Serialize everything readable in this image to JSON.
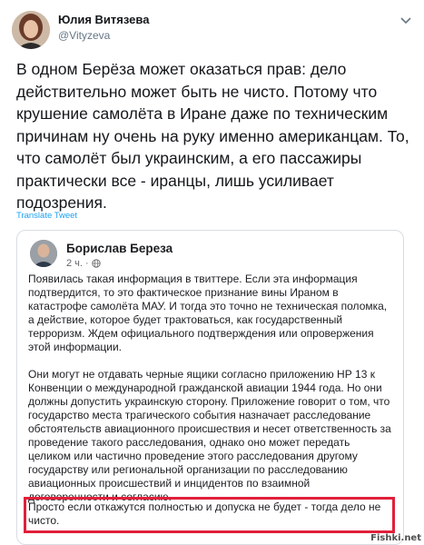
{
  "author": {
    "name": "Юлия Витязева",
    "handle": "@Vityzeva"
  },
  "tweet": {
    "text": "В одном Берёза может оказаться прав: дело действительно может быть не чисто. Потому что крушение самолёта в Иране даже по техническим причинам ну очень на руку именно американцам. То, что самолёт был украинским, а его пассажиры практически все - иранцы, лишь усиливает подозрения.",
    "translate_label": "Translate Tweet"
  },
  "quoted_post": {
    "author_name": "Борислав Береза",
    "time": "2 ч.",
    "paragraph_1": "Появилась такая информация в твиттере. Если эта информация подтвердится, то это фактическое признание вины Ираном в катастрофе самолёта МАУ. И тогда это точно не техническая поломка, а действие, которое будет трактоваться, как государственный терроризм. Ждем официального подтверждения или опровержения этой информации.",
    "paragraph_2": "Они могут не отдавать черные ящики согласно приложению НР 13 к Конвенции о международной гражданской авиации 1944 года. Но они должны допустить украинскую сторону. Приложение говорит о том, что государство места трагического события назначает расследование обстоятельств авиационного происшествия и несет ответственность за проведение такого расследования, однако оно может передать целиком или частично проведение этого расследования другому государству или региональной организации по расследованию авиационных происшествий и инцидентов по взаимной договоренности и согласию.",
    "highlighted_text": "Просто если откажутся полностью и допуска не будет - тогда дело не чисто."
  },
  "watermark": "Fishki.net",
  "colors": {
    "link": "#1da1f2",
    "highlight_border": "#e0203a"
  },
  "icons": {
    "menu": "chevron-down-icon",
    "privacy": "globe-icon"
  }
}
